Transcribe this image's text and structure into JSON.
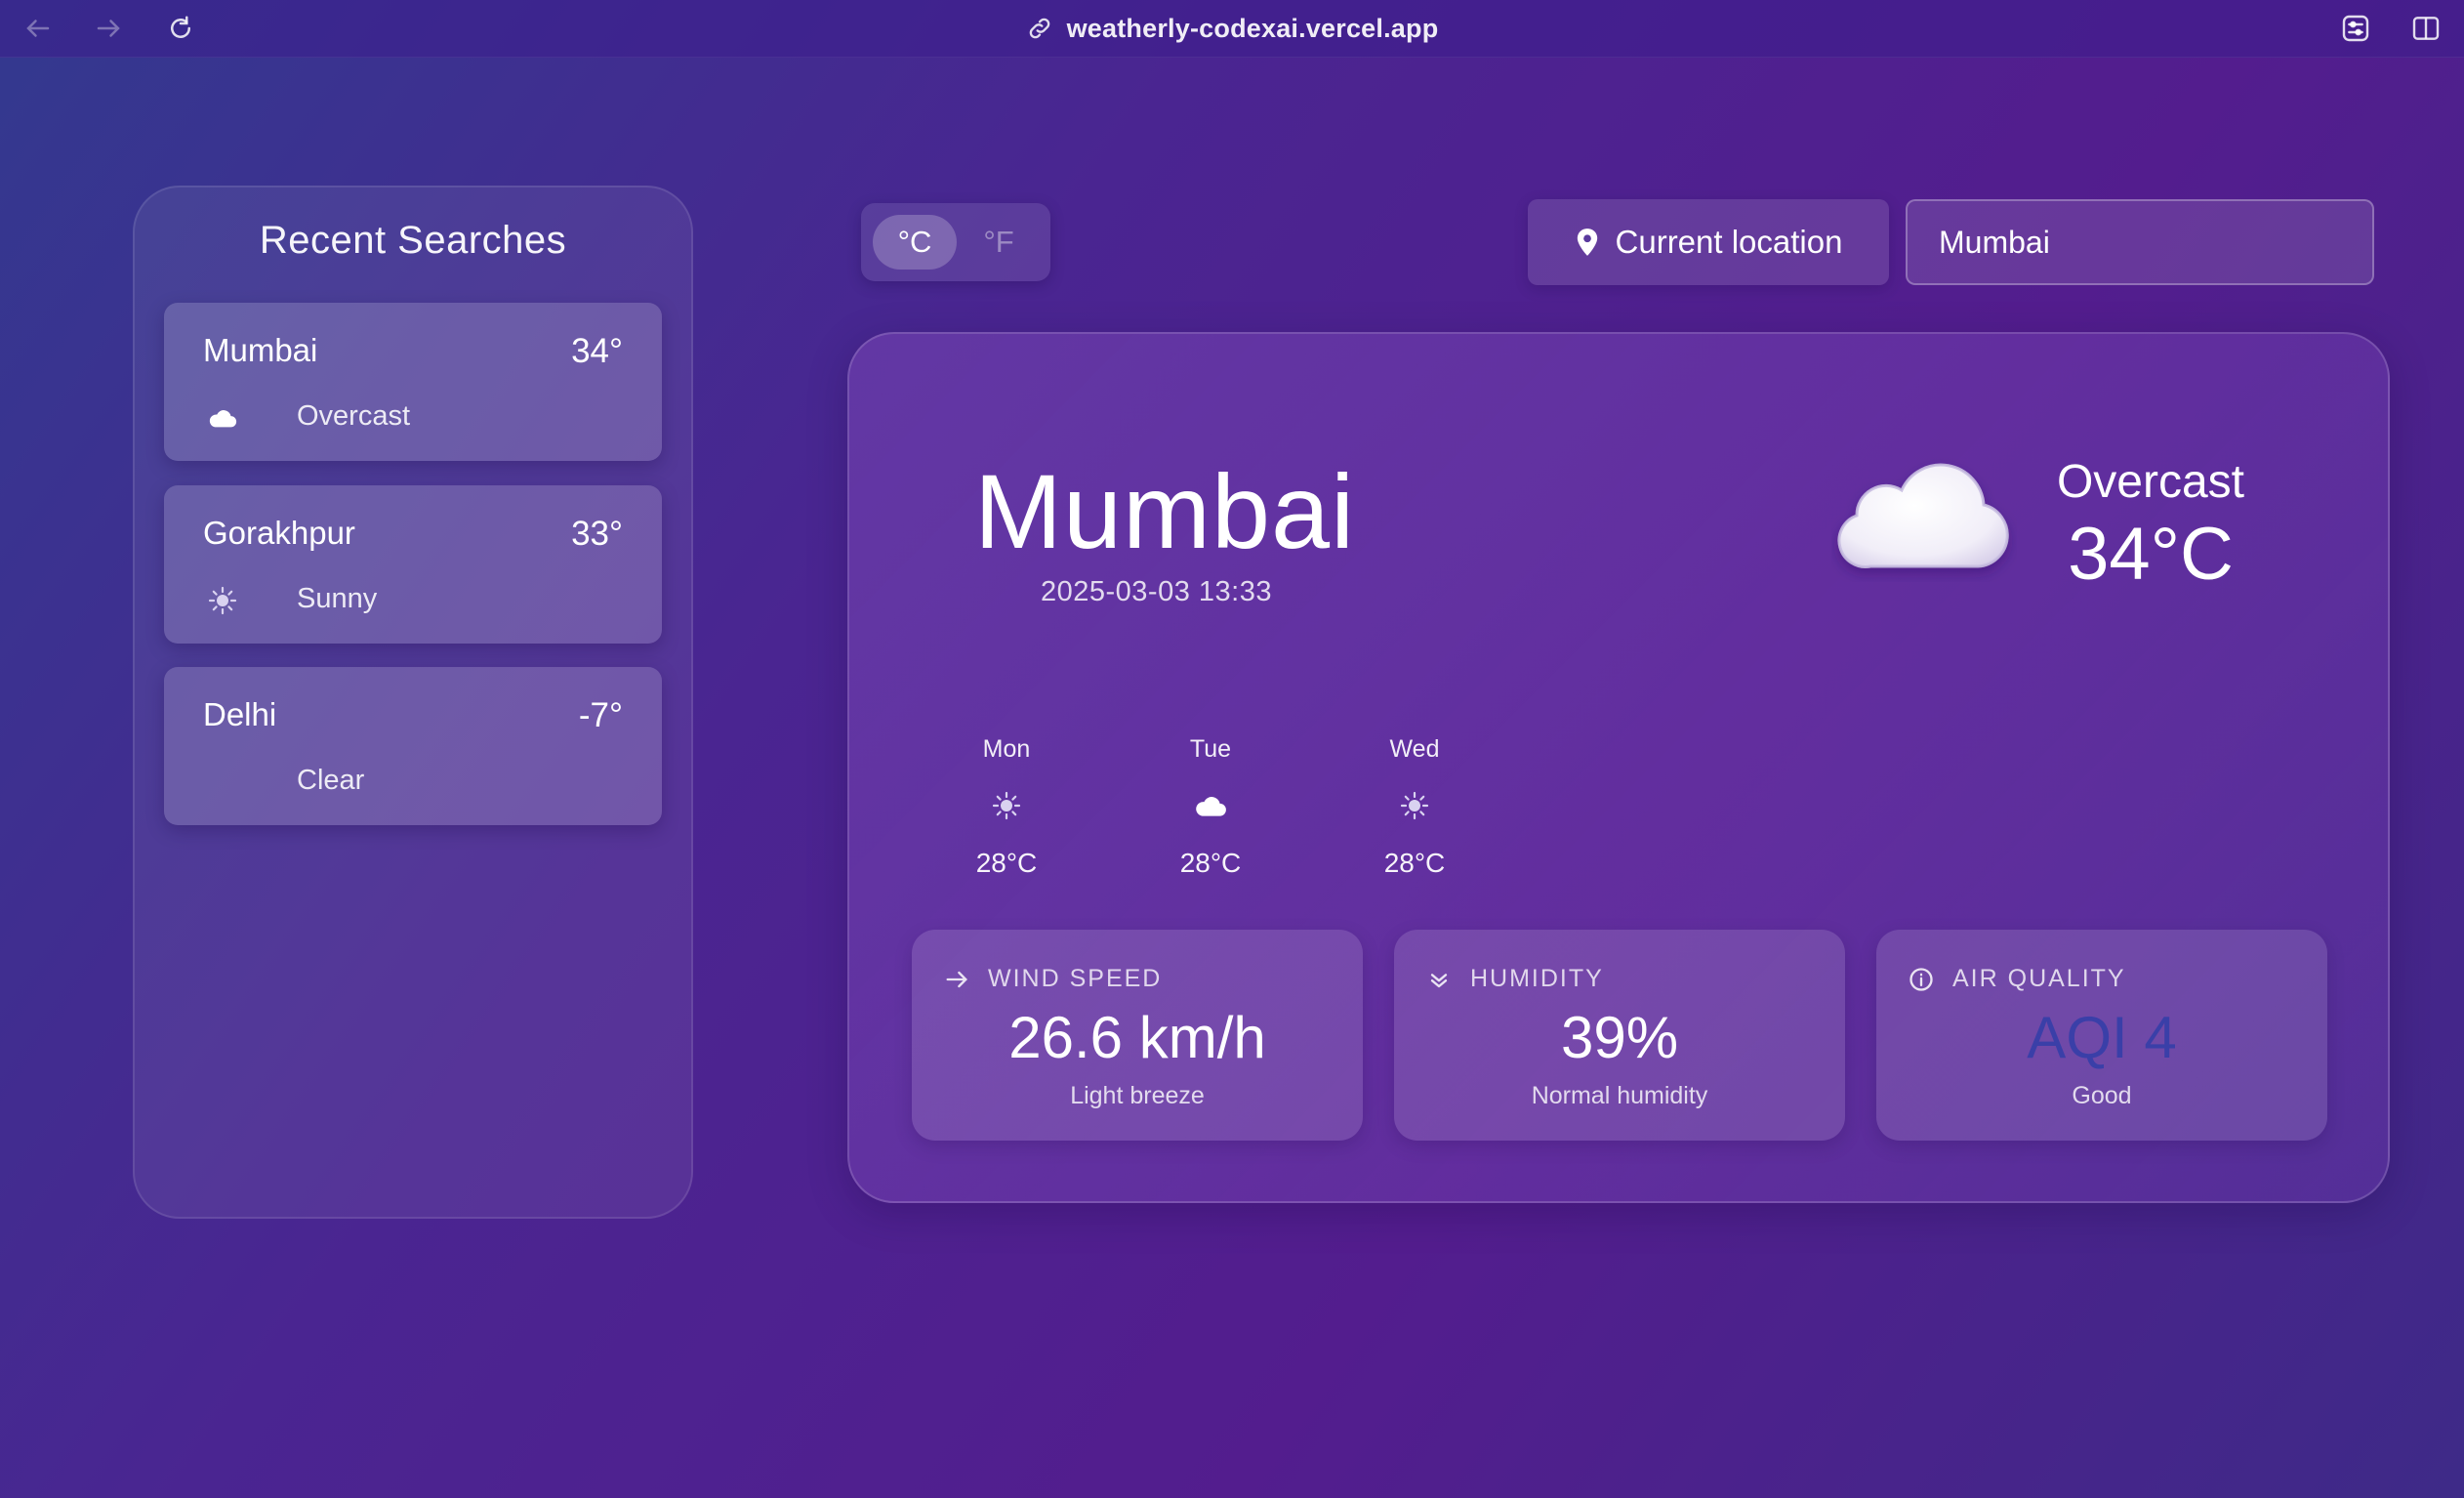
{
  "browser": {
    "url": "weatherly-codexai.vercel.app",
    "back_icon": "arrow-left-icon",
    "forward_icon": "arrow-right-icon",
    "reload_icon": "reload-icon"
  },
  "sidebar": {
    "title": "Recent Searches",
    "items": [
      {
        "city": "Mumbai",
        "temp": "34°",
        "condition": "Overcast",
        "icon": "cloud-icon"
      },
      {
        "city": "Gorakhpur",
        "temp": "33°",
        "condition": "Sunny",
        "icon": "sun-icon"
      },
      {
        "city": "Delhi",
        "temp": "-7°",
        "condition": "Clear",
        "icon": "moon-icon"
      }
    ]
  },
  "units": {
    "celsius": "°C",
    "fahrenheit": "°F",
    "selected": "celsius"
  },
  "location_button": {
    "label": "Current location",
    "icon": "map-pin-icon"
  },
  "search": {
    "value": "Mumbai"
  },
  "current": {
    "city": "Mumbai",
    "datetime": "2025-03-03 13:33",
    "condition": "Overcast",
    "temp": "34°C",
    "icon": "cloud-icon"
  },
  "forecast": [
    {
      "day": "Mon",
      "temp": "28°C",
      "icon": "sun-icon"
    },
    {
      "day": "Tue",
      "temp": "28°C",
      "icon": "cloud-icon"
    },
    {
      "day": "Wed",
      "temp": "28°C",
      "icon": "sun-icon"
    }
  ],
  "stats": {
    "wind": {
      "label": "WIND SPEED",
      "value": "26.6 km/h",
      "sub": "Light breeze",
      "icon": "arrow-right-icon"
    },
    "humidity": {
      "label": "HUMIDITY",
      "value": "39%",
      "sub": "Normal humidity",
      "icon": "chevrons-down-icon"
    },
    "air_quality": {
      "label": "AIR QUALITY",
      "value": "AQI 4",
      "sub": "Good",
      "icon": "info-icon"
    }
  },
  "colors": {
    "aqi_value": "#3a3fa8",
    "background_start": "#33398f",
    "background_end": "#531d8e"
  }
}
